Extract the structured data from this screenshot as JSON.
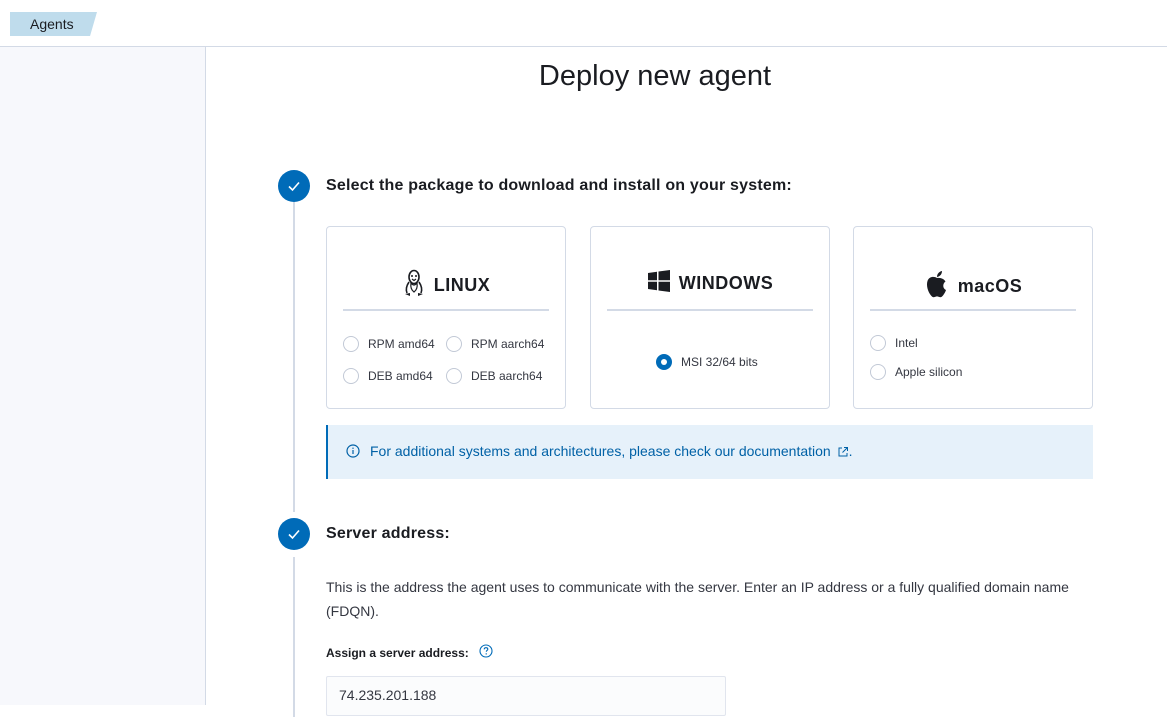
{
  "header": {
    "breadcrumb": "Agents"
  },
  "page": {
    "title": "Deploy new agent"
  },
  "steps": [
    {
      "title": "Select the package to download and install on your system:",
      "os_cards": [
        {
          "name": "LINUX",
          "icon": "linux-tux-icon",
          "options": [
            "RPM amd64",
            "RPM aarch64",
            "DEB amd64",
            "DEB aarch64"
          ],
          "selected": null
        },
        {
          "name": "WINDOWS",
          "icon": "windows-logo-icon",
          "options": [
            "MSI 32/64 bits"
          ],
          "selected": "MSI 32/64 bits"
        },
        {
          "name": "macOS",
          "icon": "apple-logo-icon",
          "options": [
            "Intel",
            "Apple silicon"
          ],
          "selected": null
        }
      ],
      "callout": {
        "text": "For additional systems and architectures, please check our documentation",
        "suffix": ".",
        "icon": "info-icon",
        "link_icon": "external-link-icon"
      }
    },
    {
      "title": "Server address:",
      "description": "This is the address the agent uses to communicate with the server. Enter an IP address or a fully qualified domain name (FDQN).",
      "field_label": "Assign a server address:",
      "field_value": "74.235.201.188",
      "help_icon": "question-circle-icon"
    }
  ],
  "colors": {
    "accent": "#006bb8",
    "callout_bg": "#e6f1fa",
    "breadcrumb_bg": "#bfdcec"
  }
}
